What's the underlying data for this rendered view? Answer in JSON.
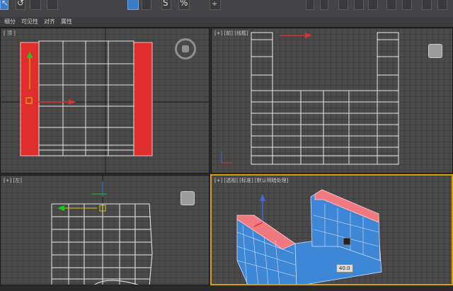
{
  "toolbar": {
    "glyphs": [
      {
        "name": "select-icon",
        "char": "↖"
      },
      {
        "name": "undo-icon",
        "char": "↺"
      },
      {
        "name": "link-icon",
        "char": "⛓"
      },
      {
        "name": "window-crossing-icon",
        "char": "▤"
      },
      {
        "name": "snap-icon",
        "char": "S"
      },
      {
        "name": "percent-snap-icon",
        "char": "%"
      },
      {
        "name": "mirror-icon",
        "char": "⨴"
      }
    ]
  },
  "tabs": [
    "细分",
    "可见性",
    "对齐",
    "属性"
  ],
  "viewports": {
    "top_left": {
      "label": "[ 顶 ]"
    },
    "top_right": {
      "label": "[+] [前] [线框]"
    },
    "bottom_left": {
      "label": "[+] [左]"
    },
    "bottom_right": {
      "label": "[+] [透视] [标准] [默认明暗处理]"
    }
  },
  "hint": {
    "text": "40.0"
  },
  "colors": {
    "accent": "#d6a300",
    "selection": "#e0383a",
    "mesh_blue": "#3e86d6"
  }
}
